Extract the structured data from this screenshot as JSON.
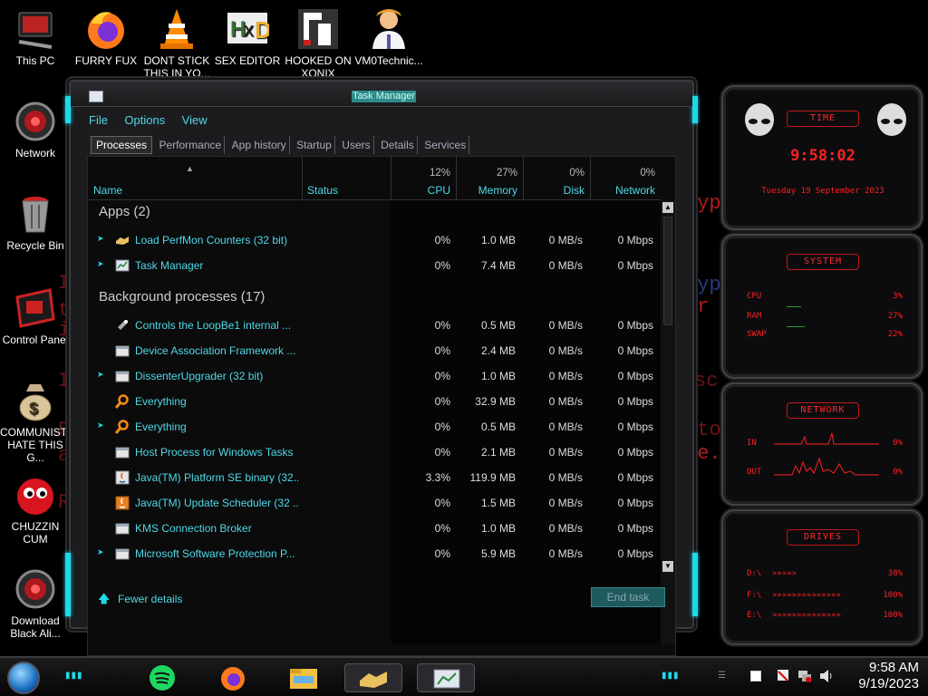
{
  "desktop": {
    "bg_lines": [
      {
        "text": "I:",
        "color": "#6a1414"
      },
      {
        "text": "th",
        "color": "#6a1414"
      },
      {
        "text": "if",
        "color": "#6a1414"
      },
      {
        "text": "I:",
        "color": "#6a1414"
      },
      {
        "text": "R",
        "color": "#6a1414"
      },
      {
        "text": "an",
        "color": "#6a1414"
      },
      {
        "text": "Ru",
        "color": "#6a1414"
      },
      {
        "text": "ryp",
        "color": "#b01c1c"
      },
      {
        "text": "ryp",
        "color": "#6a1414"
      },
      {
        "text": "or",
        "color": "#b01c1c"
      },
      {
        "text": "sc",
        "color": "#6a1414"
      },
      {
        "text": "oto",
        "color": "#6a1414"
      },
      {
        "text": "ne.",
        "color": "#b01c1c"
      }
    ],
    "icons": [
      {
        "label": "This PC",
        "icon": "computer-icon"
      },
      {
        "label": "FURRY FUX",
        "icon": "firefox-icon"
      },
      {
        "label": "DONT STICK THIS IN YO...",
        "icon": "vlc-cone-icon"
      },
      {
        "label": "SEX EDITOR",
        "icon": "hex-editor-icon"
      },
      {
        "label": "HOOKED ON XONIX",
        "icon": "xonix-game-icon"
      },
      {
        "label": "VM0Technic...",
        "icon": "doctor-icon"
      },
      {
        "label": "Network",
        "icon": "network-orb-icon"
      },
      {
        "label": "Recycle Bin",
        "icon": "recycle-bin-icon"
      },
      {
        "label": "Control Panel",
        "icon": "control-panel-icon"
      },
      {
        "label": "COMMUNISTS HATE THIS G...",
        "icon": "money-bag-icon"
      },
      {
        "label": "CHUZZIN CUM",
        "icon": "chuzzle-icon"
      },
      {
        "label": "Download Black Ali...",
        "icon": "alienware-orb-icon"
      }
    ]
  },
  "taskmanager": {
    "title": "Task Manager",
    "menu": [
      "File",
      "Options",
      "View"
    ],
    "tabs": [
      "Processes",
      "Performance",
      "App history",
      "Startup",
      "Users",
      "Details",
      "Services"
    ],
    "active_tab": "Processes",
    "columns": {
      "name": "Name",
      "status": "Status",
      "cpu": {
        "pct": "12%",
        "label": "CPU"
      },
      "memory": {
        "pct": "27%",
        "label": "Memory"
      },
      "disk": {
        "pct": "0%",
        "label": "Disk"
      },
      "network": {
        "pct": "0%",
        "label": "Network"
      }
    },
    "groups": [
      {
        "title": "Apps (2)",
        "rows": [
          {
            "name": "Load PerfMon Counters (32 bit)",
            "icon": "handshake-icon",
            "expandable": true,
            "cpu": "0%",
            "memory": "1.0 MB",
            "disk": "0 MB/s",
            "network": "0 Mbps"
          },
          {
            "name": "Task Manager",
            "icon": "task-manager-icon",
            "expandable": true,
            "cpu": "0%",
            "memory": "7.4 MB",
            "disk": "0 MB/s",
            "network": "0 Mbps"
          }
        ]
      },
      {
        "title": "Background processes (17)",
        "rows": [
          {
            "name": "Controls the LoopBe1 internal ...",
            "icon": "loopbe-icon",
            "expandable": false,
            "cpu": "0%",
            "memory": "0.5 MB",
            "disk": "0 MB/s",
            "network": "0 Mbps"
          },
          {
            "name": "Device Association Framework ...",
            "icon": "window-icon",
            "expandable": false,
            "cpu": "0%",
            "memory": "2.4 MB",
            "disk": "0 MB/s",
            "network": "0 Mbps"
          },
          {
            "name": "DissenterUpgrader (32 bit)",
            "icon": "window-icon",
            "expandable": true,
            "cpu": "0%",
            "memory": "1.0 MB",
            "disk": "0 MB/s",
            "network": "0 Mbps"
          },
          {
            "name": "Everything",
            "icon": "magnifier-icon",
            "expandable": false,
            "cpu": "0%",
            "memory": "32.9 MB",
            "disk": "0 MB/s",
            "network": "0 Mbps"
          },
          {
            "name": "Everything",
            "icon": "magnifier-icon",
            "expandable": true,
            "cpu": "0%",
            "memory": "0.5 MB",
            "disk": "0 MB/s",
            "network": "0 Mbps"
          },
          {
            "name": "Host Process for Windows Tasks",
            "icon": "window-icon",
            "expandable": false,
            "cpu": "0%",
            "memory": "2.1 MB",
            "disk": "0 MB/s",
            "network": "0 Mbps"
          },
          {
            "name": "Java(TM) Platform SE binary (32...",
            "icon": "java-icon",
            "expandable": false,
            "cpu": "3.3%",
            "memory": "119.9 MB",
            "disk": "0 MB/s",
            "network": "0 Mbps"
          },
          {
            "name": "Java(TM) Update Scheduler (32 ...",
            "icon": "java-update-icon",
            "expandable": false,
            "cpu": "0%",
            "memory": "1.5 MB",
            "disk": "0 MB/s",
            "network": "0 Mbps"
          },
          {
            "name": "KMS Connection Broker",
            "icon": "window-icon",
            "expandable": false,
            "cpu": "0%",
            "memory": "1.0 MB",
            "disk": "0 MB/s",
            "network": "0 Mbps"
          },
          {
            "name": "Microsoft Software Protection P...",
            "icon": "window-icon",
            "expandable": true,
            "cpu": "0%",
            "memory": "5.9 MB",
            "disk": "0 MB/s",
            "network": "0 Mbps"
          }
        ]
      }
    ],
    "fewer_details": "Fewer details",
    "end_task": "End task"
  },
  "gadgets": {
    "time": {
      "title": "TIME",
      "clock": "9:58:02",
      "date": "Tuesday 19 September 2023"
    },
    "system": {
      "title": "SYSTEM",
      "rows": [
        {
          "label": "CPU",
          "value": "3%"
        },
        {
          "label": "RAM",
          "value": "27%"
        },
        {
          "label": "SWAP",
          "value": "22%"
        }
      ]
    },
    "network": {
      "title": "NETWORK",
      "rows": [
        {
          "label": "IN",
          "value": "0%"
        },
        {
          "label": "OUT",
          "value": "0%"
        }
      ]
    },
    "drives": {
      "title": "DRIVES",
      "rows": [
        {
          "label": "D:\\",
          "value": "38%"
        },
        {
          "label": "F:\\",
          "value": "100%"
        },
        {
          "label": "E:\\",
          "value": "100%"
        }
      ]
    },
    "accent": "#ff2020"
  },
  "taskbar": {
    "time": "9:58 AM",
    "date": "9/19/2023",
    "items": [
      "start-orb-icon",
      "spotify-icon",
      "firefox-icon",
      "file-explorer-icon",
      "handshake-icon",
      "task-manager-icon"
    ],
    "tray": [
      "show-desktop-icon",
      "shield-flag-icon",
      "network-icon",
      "volume-icon"
    ]
  }
}
